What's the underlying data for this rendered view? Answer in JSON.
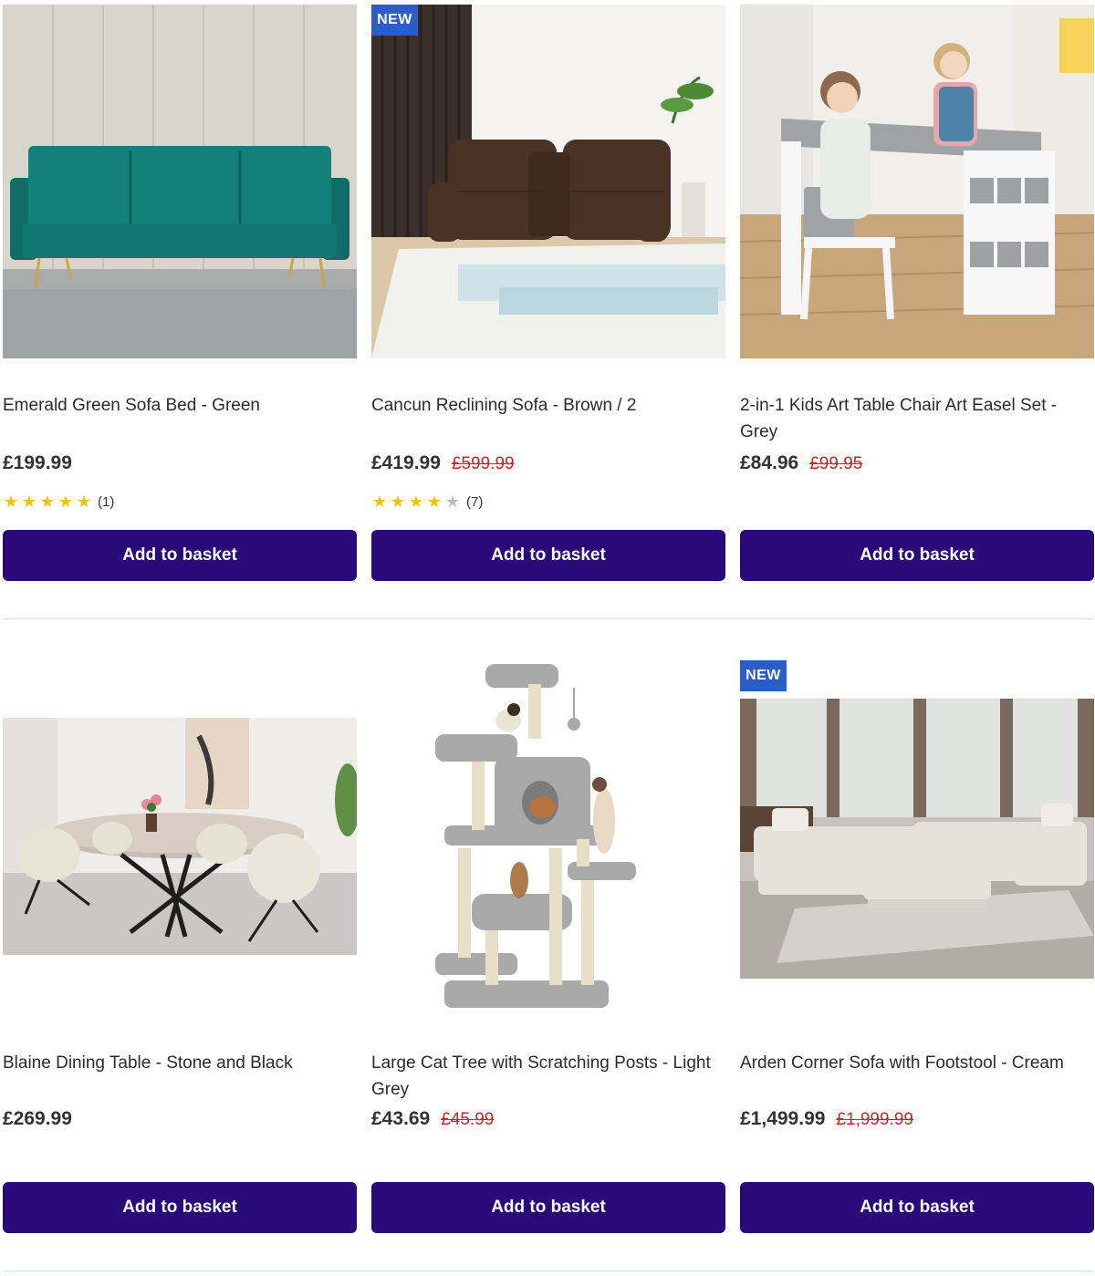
{
  "button_label": "Add to basket",
  "badge_new": "NEW",
  "colors": {
    "button_bg": "#2a0a7a",
    "badge_bg": "#2b5cc8",
    "was_price": "#d0231e",
    "star_filled": "#f4c20d",
    "star_empty": "#b8bfc9",
    "divider": "#cfe3d6"
  },
  "products": [
    {
      "title": "Emerald Green Sofa Bed - Green",
      "price": "£199.99",
      "was_price": "",
      "rating": 5,
      "rating_count": "(1)",
      "is_new": false,
      "image_icon": "green-sofa-bed-image"
    },
    {
      "title": "Cancun Reclining Sofa - Brown / 2",
      "price": "£419.99",
      "was_price": "£599.99",
      "rating": 4,
      "rating_count": "(7)",
      "is_new": true,
      "image_icon": "brown-recliner-sofa-image"
    },
    {
      "title": "2-in-1 Kids Art Table Chair Art Easel Set - Grey",
      "price": "£84.96",
      "was_price": "£99.95",
      "rating": null,
      "rating_count": "",
      "is_new": false,
      "image_icon": "kids-art-table-image"
    },
    {
      "title": "Blaine Dining Table - Stone and Black",
      "price": "£269.99",
      "was_price": "",
      "rating": null,
      "rating_count": "",
      "is_new": false,
      "image_icon": "dining-table-image"
    },
    {
      "title": "Large Cat Tree with Scratching Posts - Light Grey",
      "price": "£43.69",
      "was_price": "£45.99",
      "rating": null,
      "rating_count": "",
      "is_new": false,
      "image_icon": "cat-tree-image"
    },
    {
      "title": "Arden Corner Sofa with Footstool - Cream",
      "price": "£1,499.99",
      "was_price": "£1,999.99",
      "rating": null,
      "rating_count": "",
      "is_new": true,
      "image_icon": "corner-sofa-image"
    }
  ]
}
